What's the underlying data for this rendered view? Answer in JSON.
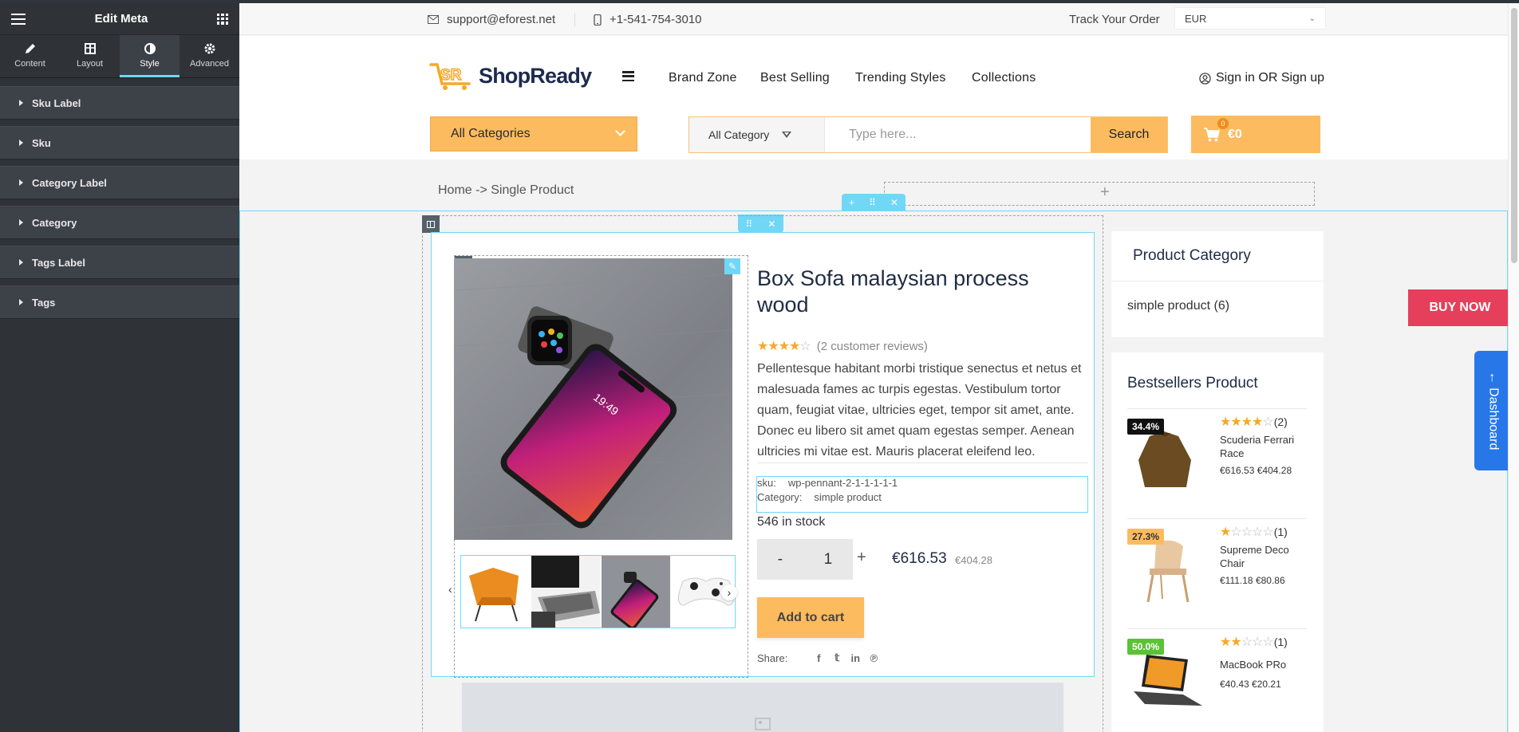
{
  "panel": {
    "title": "Edit Meta",
    "tabs": [
      {
        "label": "Content",
        "icon": "pencil-icon"
      },
      {
        "label": "Layout",
        "icon": "layout-icon"
      },
      {
        "label": "Style",
        "icon": "half-circle-icon",
        "active": true
      },
      {
        "label": "Advanced",
        "icon": "gear-icon"
      }
    ],
    "sections": [
      "Sku Label",
      "Sku",
      "Category Label",
      "Category",
      "Tags Label",
      "Tags"
    ]
  },
  "topbar": {
    "email": "support@eforest.net",
    "phone": "+1-541-754-3010",
    "track": "Track Your Order",
    "currency": "EUR"
  },
  "header": {
    "logo_mark": "SR",
    "logo_text": "ShopReady",
    "nav": [
      "Brand Zone",
      "Best Selling",
      "Trending Styles",
      "Collections"
    ],
    "signin": "Sign in OR Sign up",
    "all_categories": "All Categories",
    "search_category": "All Category",
    "search_placeholder": "Type here...",
    "search_button": "Search",
    "cart_count": "0",
    "cart_total": "€0"
  },
  "breadcrumb": "Home -> Single Product",
  "product": {
    "title": "Box Sofa malaysian process wood",
    "rating": 4,
    "reviews": "(2 customer reviews)",
    "description": "Pellentesque habitant morbi tristique senectus et netus et malesuada fames ac turpis egestas. Vestibulum tortor quam, feugiat vitae, ultricies eget, tempor sit amet, ante. Donec eu libero sit amet quam egestas semper. Aenean ultricies mi vitae est. Mauris placerat eleifend leo.",
    "sku_label": "sku:",
    "sku": "wp-pennant-2-1-1-1-1-1",
    "category_label": "Category:",
    "category": "simple product",
    "stock": "546 in stock",
    "qty": "1",
    "price": "€616.53",
    "old_price": "€404.28",
    "add_to_cart": "Add to cart",
    "share_label": "Share:"
  },
  "sidebar": {
    "category_title": "Product Category",
    "category_item": "simple product",
    "category_count": "(6)",
    "best_title": "Bestsellers Product",
    "items": [
      {
        "discount": "34.4%",
        "badge_color": "#111111",
        "rating": 4,
        "count": "(2)",
        "name": "Scuderia Ferrari Race",
        "price": "€616.53",
        "old": "€404.28"
      },
      {
        "discount": "27.3%",
        "badge_color": "#fdbb5f",
        "rating": 1,
        "count": "(1)",
        "name": "Supreme Deco Chair",
        "price": "€111.18",
        "old": "€80.86"
      },
      {
        "discount": "50.0%",
        "badge_color": "#5bc236",
        "rating": 2,
        "count": "(1)",
        "name": "MacBook PRo",
        "price": "€40.43",
        "old": "€20.21"
      }
    ]
  },
  "buy_now": "BUY NOW",
  "dashboard": "← Dashboard",
  "colors": {
    "accent": "#fdbb5f",
    "editor": "#71d7f7",
    "buy_now": "#e63f5b",
    "dashboard": "#2877e9"
  }
}
